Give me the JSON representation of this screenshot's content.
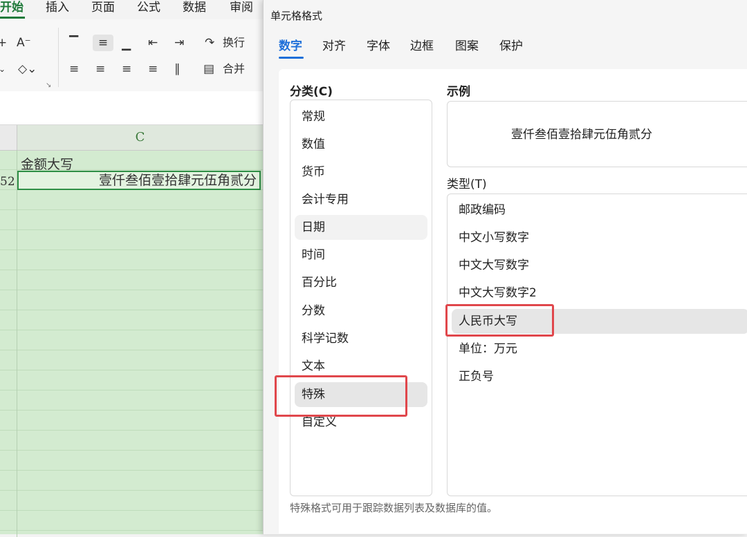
{
  "ribbon": {
    "tabs": [
      "开始",
      "插入",
      "页面",
      "公式",
      "数据",
      "审阅"
    ],
    "active_tab": "开始",
    "accent_color": "#1f7a3a",
    "wrap_label": "换行",
    "merge_label": "合并"
  },
  "sheet": {
    "column_header": "C",
    "row2_number_fragment": "52",
    "cell_c1": "金额大写",
    "cell_c2": "壹仟叁佰壹拾肆元伍角贰分",
    "background_color": "#d3ebd0"
  },
  "dialog": {
    "title": "单元格格式",
    "tabs": [
      "数字",
      "对齐",
      "字体",
      "边框",
      "图案",
      "保护"
    ],
    "active_tab": "数字",
    "accent_color": "#1e6fd9",
    "category_label": "分类(C)",
    "categories": [
      "常规",
      "数值",
      "货币",
      "会计专用",
      "日期",
      "时间",
      "百分比",
      "分数",
      "科学记数",
      "文本",
      "特殊",
      "自定义"
    ],
    "selected_category": "特殊",
    "sample_label": "示例",
    "sample_value": "壹仟叁佰壹拾肆元伍角贰分",
    "type_label": "类型(T)",
    "types": [
      "邮政编码",
      "中文小写数字",
      "中文大写数字",
      "中文大写数字2",
      "人民币大写",
      "单位：万元",
      "正负号"
    ],
    "selected_type": "人民币大写",
    "footer_hint": "特殊格式可用于跟踪数据列表及数据库的值。",
    "highlight_color": "#e0474c"
  }
}
